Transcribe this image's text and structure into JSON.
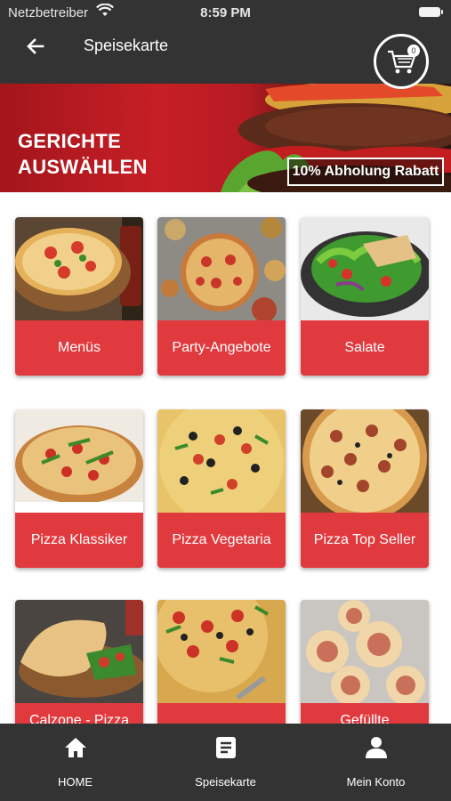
{
  "status_bar": {
    "carrier": "Netzbetreiber",
    "time": "8:59 PM"
  },
  "app_bar": {
    "title": "Speisekarte",
    "cart_count": "0"
  },
  "banner": {
    "title": "GERICHTE AUSWÄHLEN",
    "badge": "10% Abholung Rabatt"
  },
  "categories": [
    {
      "label": "Menüs",
      "image": "pizza-with-drink"
    },
    {
      "label": "Party-Angebote",
      "image": "party-food-table"
    },
    {
      "label": "Salate",
      "image": "salad-bowl"
    },
    {
      "label": "Pizza Klassiker",
      "image": "pizza-tomato-rucola"
    },
    {
      "label": "Pizza Vegetaria",
      "image": "pizza-vegetarian"
    },
    {
      "label": "Pizza Top Seller",
      "image": "pizza-salami"
    },
    {
      "label": "Calzone - Pizza",
      "image": "calzone"
    },
    {
      "label": "",
      "image": "pizza-olives"
    },
    {
      "label": "Gefüllte",
      "image": "filled-rolls"
    }
  ],
  "bottom_nav": [
    {
      "label": "HOME",
      "icon": "home-icon"
    },
    {
      "label": "Speisekarte",
      "icon": "menu-book-icon"
    },
    {
      "label": "Mein Konto",
      "icon": "user-icon"
    }
  ],
  "colors": {
    "bar": "#333333",
    "accent": "#e13a3e"
  }
}
